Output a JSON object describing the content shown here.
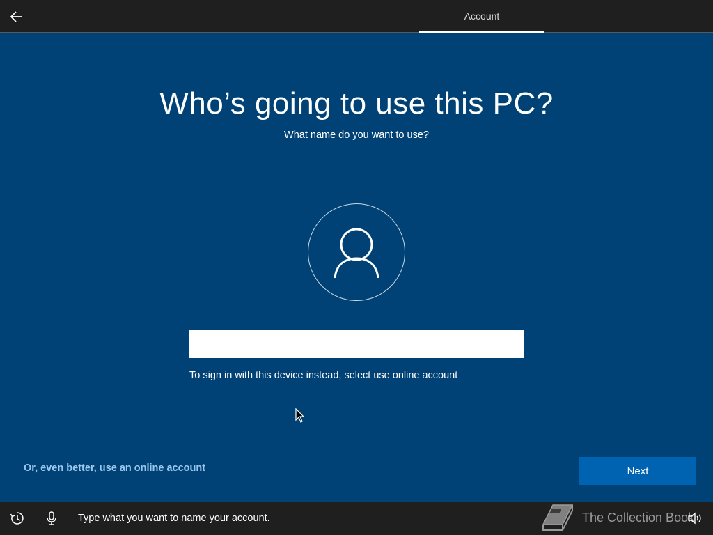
{
  "header": {
    "tab_label": "Account"
  },
  "main": {
    "title": "Who’s going to use this PC?",
    "subtitle": "What name do you want to use?",
    "name_input_value": "",
    "hint": "To sign in with this device instead, select use online account"
  },
  "footer": {
    "online_account_link": "Or, even better, use an online account",
    "next_label": "Next"
  },
  "status_bar": {
    "narrator_text": "Type what you want to name your account.",
    "watermark": "The Collection Book"
  },
  "icons": {
    "back": "back-arrow-icon",
    "avatar": "user-icon",
    "accessibility": "ease-of-access-icon",
    "microphone": "microphone-icon",
    "volume": "volume-icon"
  },
  "colors": {
    "background": "#004275",
    "top_bar": "#1f1f1f",
    "bottom_bar": "#1f1f1f",
    "primary_button": "#0063b1",
    "link": "#9cc8f0"
  }
}
